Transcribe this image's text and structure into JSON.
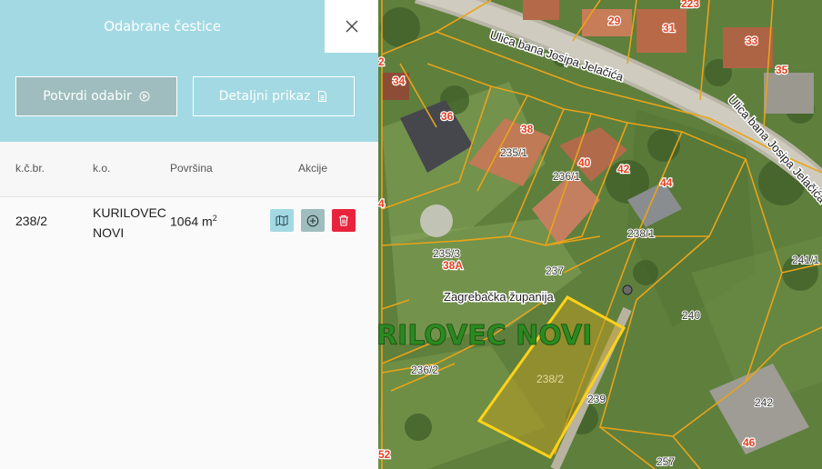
{
  "panel": {
    "title": "Odabrane čestice",
    "confirm_button": "Potvrdi odabir",
    "detail_button": "Detaljni prikaz"
  },
  "table": {
    "columns": [
      "k.č.br.",
      "k.o.",
      "Površina",
      "Akcije"
    ],
    "rows": [
      {
        "parcel_no": "238/2",
        "ko_line1": "KURILOVEC",
        "ko_line2": "NOVI",
        "area": "1064 m",
        "area_unit_sup": "2"
      }
    ]
  },
  "map": {
    "street_label": "Ulica bana Josipa Jelačića",
    "county_label": "Zagrebačka županija",
    "cadastral_area_label": "RILOVEC NOVI",
    "selected_parcel_label": "238/2",
    "house_numbers": [
      "29",
      "31",
      "33",
      "35",
      "34",
      "36",
      "38",
      "40",
      "42",
      "44",
      "46",
      "38A",
      "223",
      "2",
      "4",
      "52"
    ],
    "parcel_numbers": [
      "235/1",
      "236/1",
      "238/1",
      "235/3",
      "237",
      "240",
      "236/2",
      "239",
      "241/1",
      "242",
      "257"
    ],
    "colors": {
      "parcel_line": "#e8a41a",
      "selection": "#ffd21a",
      "house_number": "#e64020"
    }
  }
}
